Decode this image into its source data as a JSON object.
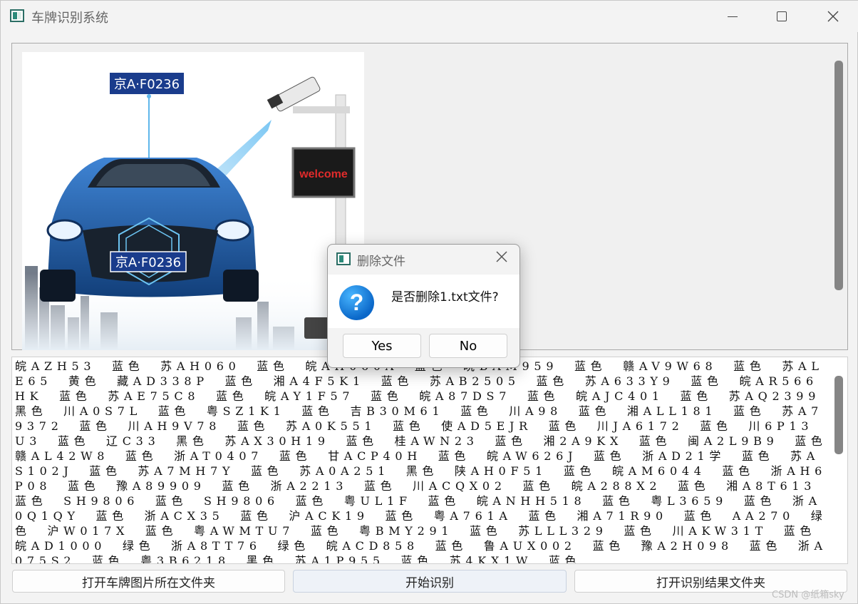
{
  "window": {
    "title": "车牌识别系统",
    "icon": "app-icon",
    "controls": [
      "minimize-icon",
      "maximize-icon",
      "close-icon"
    ]
  },
  "image": {
    "plate_top": "京A·F0236",
    "plate_car": "京A·F0236",
    "sign": "welcome"
  },
  "result_text": "皖AZH53　蓝色　苏AH060　蓝色　皖AH060A　蓝色　皖BAM959　蓝色　赣AV9W68　蓝色　苏ALE65　黄色　藏AD338P　蓝色　湘A4F5K1　蓝色　苏AB2505　蓝色　苏A633Y9　蓝色　皖AR566HK　蓝色　苏AE75C8　蓝色　皖AY1F57　蓝色　皖A87DS7　蓝色　皖AJC401　蓝色　苏AQ2399　黑色　川A0S7L　蓝色　粤SZ1K1　蓝色　吉B30M61　蓝色　川A98　蓝色　湘ALL181　蓝色　苏A79372　蓝色　川AH9V78　蓝色　苏A0K551　蓝色　使AD5EJR　蓝色　川JA6172　蓝色　川6P13U3　蓝色　辽C33　黑色　苏AX30H19　蓝色　桂AWN23　蓝色　湘2A9KX　蓝色　闽A2L9B9　蓝色　赣AL42W8　蓝色　浙AT0407　蓝色　甘ACP40H　蓝色　皖AW626J　蓝色　浙AD21学　蓝色　苏AS102J　蓝色　苏A7MH7Y　蓝色　苏A0A251　黑色　陕AH0F51　蓝色　皖AM6044　蓝色　浙AH6P08　蓝色　豫A89909　蓝色　浙A2213　蓝色　川ACQX02　蓝色　皖A288X2　蓝色　湘A8T613　蓝色　SH9806　蓝色　SH9806　蓝色　粤UL1F　蓝色　皖ANHH518　蓝色　粤L3659　蓝色　浙A0Q1QY　蓝色　浙ACX35　蓝色　沪ACK19　蓝色　粤A761A　蓝色　湘A71R90　蓝色　AA270　绿色　沪W017X　蓝色　粤AWMTU7　蓝色　粤BMY291　蓝色　苏LLL329　蓝色　川AKW31T　蓝色　皖AD1000　绿色　浙A8TT76　绿色　皖ACD858　蓝色　鲁AUX002　蓝色　豫A2H098　蓝色　浙A075S2　蓝色　粤3B6218　黑色　苏A1P955　蓝色　苏4KX1W　蓝色",
  "buttons": {
    "open_plates": "打开车牌图片所在文件夹",
    "start": "开始识别",
    "open_results": "打开识别结果文件夹"
  },
  "dialog": {
    "title": "删除文件",
    "message": "是否删除1.txt文件?",
    "yes": "Yes",
    "no": "No",
    "icon": "question-icon"
  },
  "watermark": "CSDN @纸箱sky",
  "colors": {
    "accent": "#0b68c9",
    "car": "#1f5fa8",
    "plate": "#1a3c8c"
  }
}
